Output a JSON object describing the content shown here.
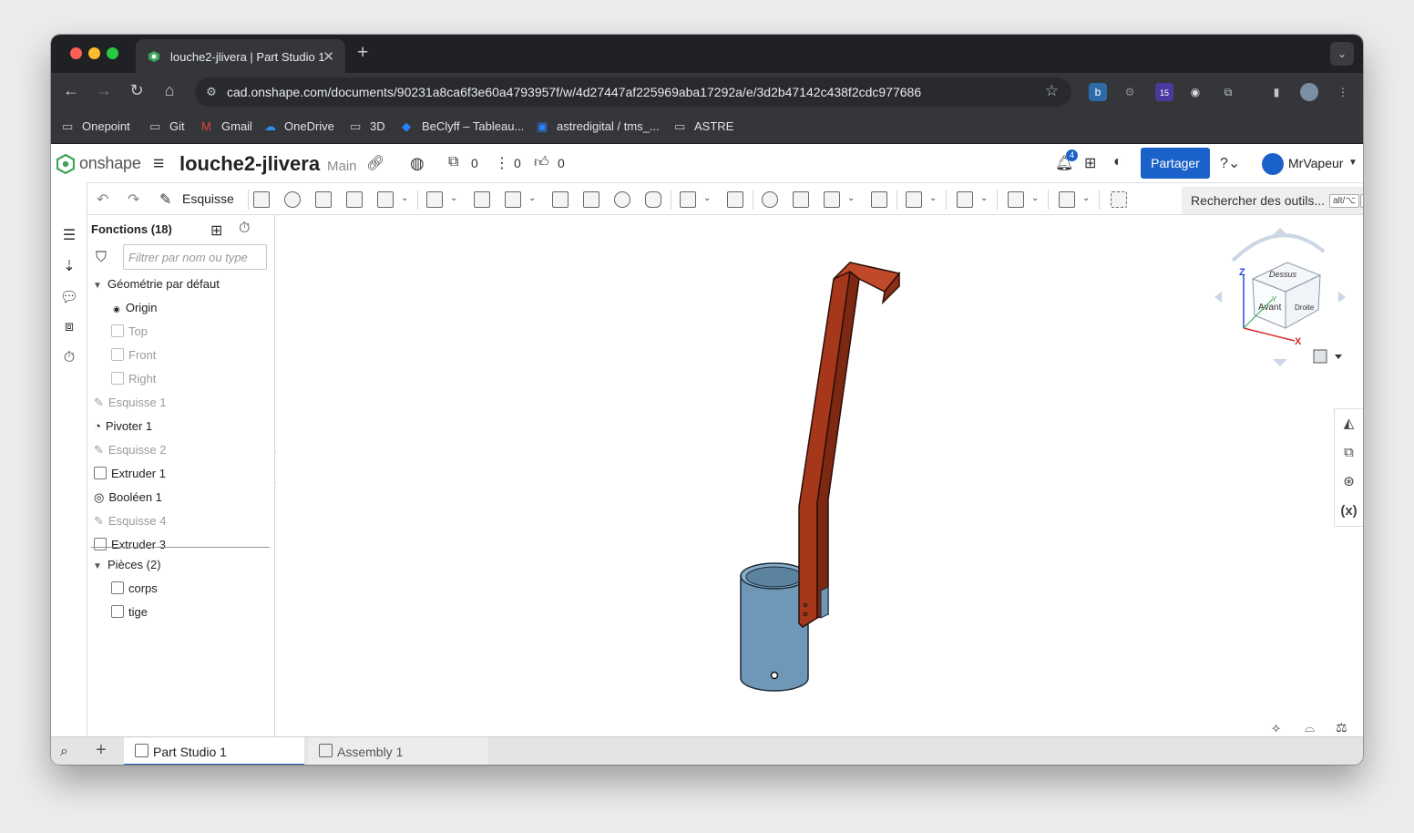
{
  "browser": {
    "tab_title": "louche2-jlivera | Part Studio 1",
    "url": "cad.onshape.com/documents/90231a8ca6f3e60a4793957f/w/4d27447af225969aba17292a/e/3d2b47142c438f2cdc977686",
    "bookmarks": [
      "Onepoint",
      "Git",
      "Gmail",
      "OneDrive",
      "3D",
      "BeClyff – Tableau...",
      "astredigital / tms_...",
      "ASTRE"
    ],
    "extension_badge": "15"
  },
  "app": {
    "brand": "onshape",
    "doc_title": "louche2-jlivera",
    "branch": "Main",
    "versions_count": "0",
    "branches_count": "0",
    "likes_count": "0",
    "notifications_count": "4",
    "share_label": "Partager",
    "user_name": "MrVapeur"
  },
  "toolbar": {
    "sketch_label": "Esquisse",
    "search_placeholder": "Rechercher des outils...",
    "search_key1": "alt/⌥",
    "search_key2": "c"
  },
  "features": {
    "header": "Fonctions (18)",
    "filter_placeholder": "Filtrer par nom ou type",
    "default_geometry": "Géométrie par défaut",
    "origin": "Origin",
    "planes": [
      "Top",
      "Front",
      "Right"
    ],
    "items": [
      "Esquisse 1",
      "Pivoter 1",
      "Esquisse 2",
      "Extruder 1",
      "Booléen 1",
      "Esquisse 4",
      "Extruder 3"
    ],
    "parts_header": "Pièces (2)",
    "parts": [
      "corps",
      "tige"
    ]
  },
  "viewcube": {
    "top": "Dessus",
    "front": "Avant",
    "right": "Droite",
    "axis_z": "Z",
    "axis_x": "X",
    "axis_y": "Y"
  },
  "bottom_tabs": [
    "Part Studio 1",
    "Assembly 1"
  ],
  "colors": {
    "accent": "#1a62c9",
    "part_tige": "#a6371a",
    "part_corps": "#6f98b8"
  }
}
